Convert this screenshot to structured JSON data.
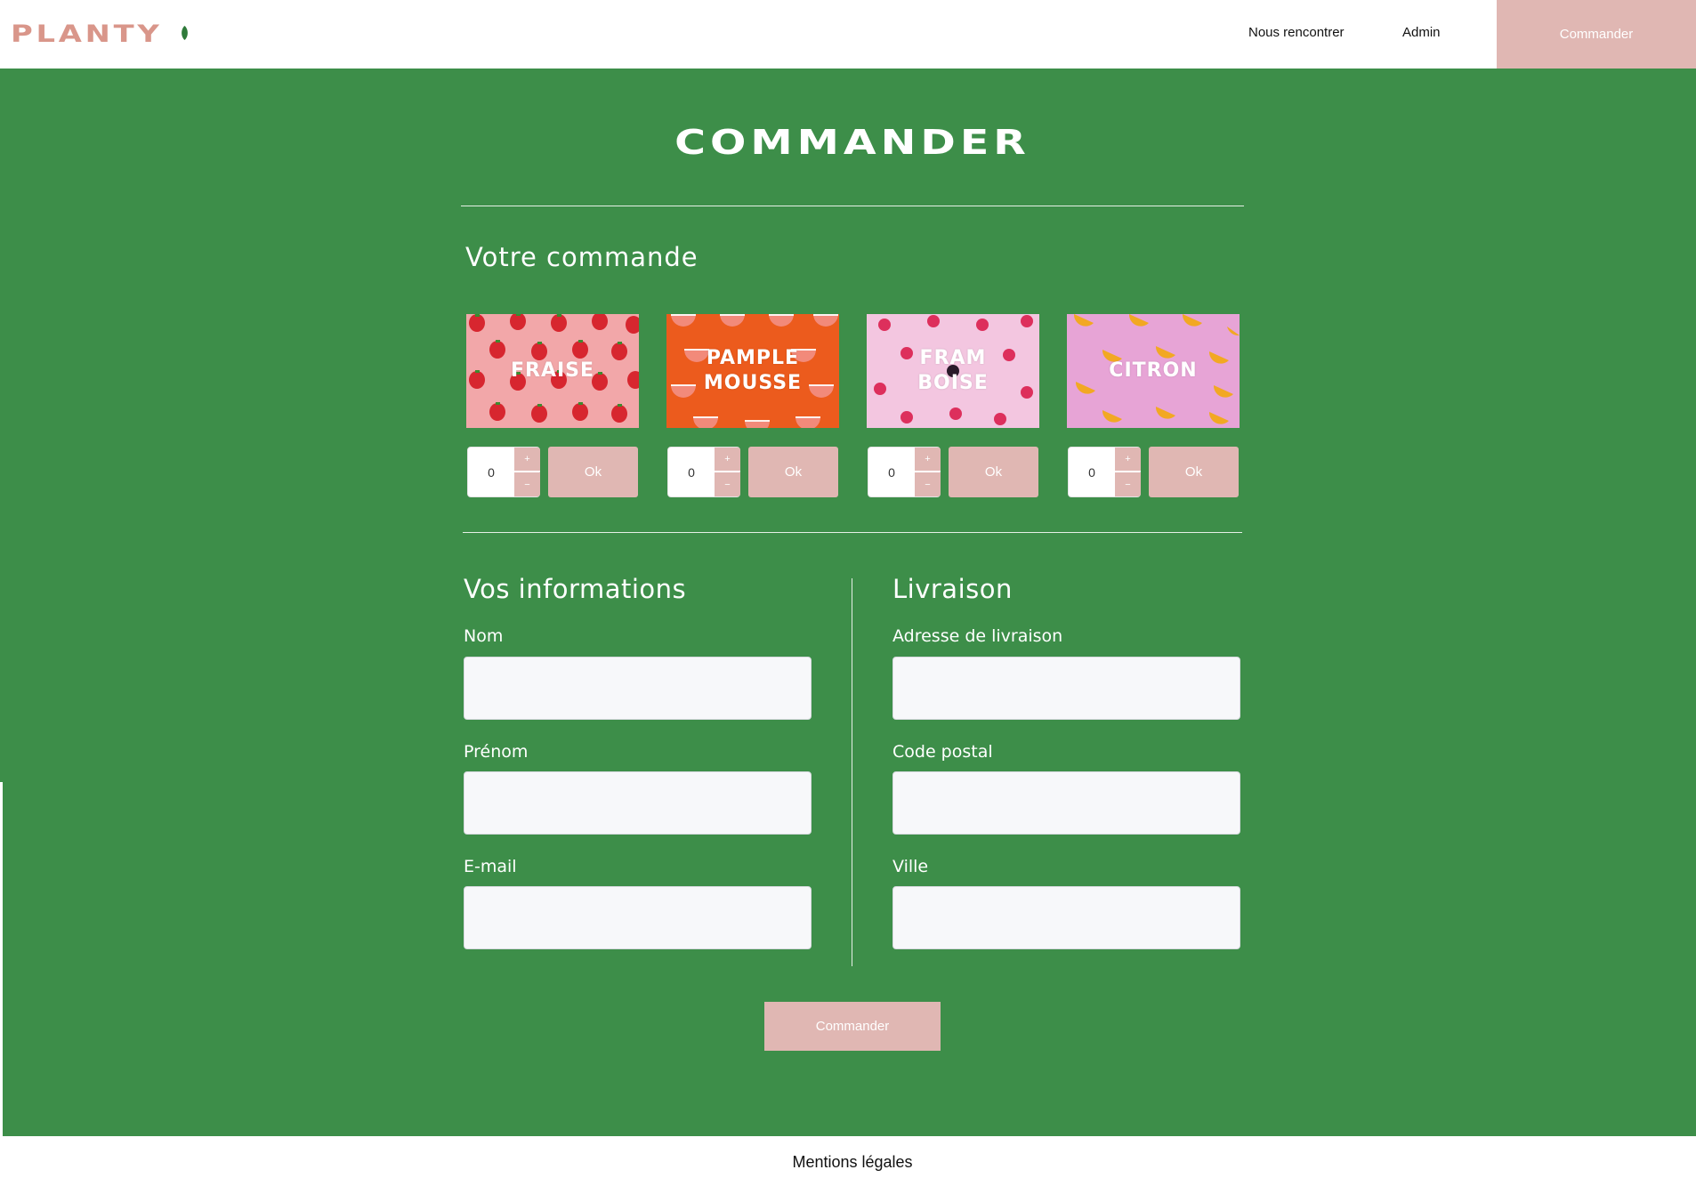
{
  "header": {
    "logo_text": "PLANTY",
    "nav": {
      "meet": "Nous rencontrer",
      "admin": "Admin",
      "order": "Commander"
    }
  },
  "page": {
    "title": "COMMANDER",
    "order_section_title": "Votre commande",
    "info_section_title": "Vos informations",
    "delivery_section_title": "Livraison"
  },
  "products": [
    {
      "label": "FRAISE",
      "quantity": "0",
      "plus": "+",
      "minus": "−",
      "ok": "Ok",
      "bg_color": "#f2a7a9"
    },
    {
      "label": "PAMPLE\nMOUSSE",
      "quantity": "0",
      "plus": "+",
      "minus": "−",
      "ok": "Ok",
      "bg_color": "#ec5b1d"
    },
    {
      "label": "FRAM\nBOISE",
      "quantity": "0",
      "plus": "+",
      "minus": "−",
      "ok": "Ok",
      "bg_color": "#f3c6e0"
    },
    {
      "label": "CITRON",
      "quantity": "0",
      "plus": "+",
      "minus": "−",
      "ok": "Ok",
      "bg_color": "#e7a4d6"
    }
  ],
  "form": {
    "info": {
      "nom_label": "Nom",
      "prenom_label": "Prénom",
      "email_label": "E-mail"
    },
    "delivery": {
      "address_label": "Adresse de livraison",
      "postal_label": "Code postal",
      "city_label": "Ville"
    },
    "submit": "Commander"
  },
  "footer": {
    "legal": "Mentions légales"
  },
  "colors": {
    "brand_green": "#3d8e49",
    "brand_pink": "#e0b7b3",
    "logo_pink": "#d9968a"
  }
}
